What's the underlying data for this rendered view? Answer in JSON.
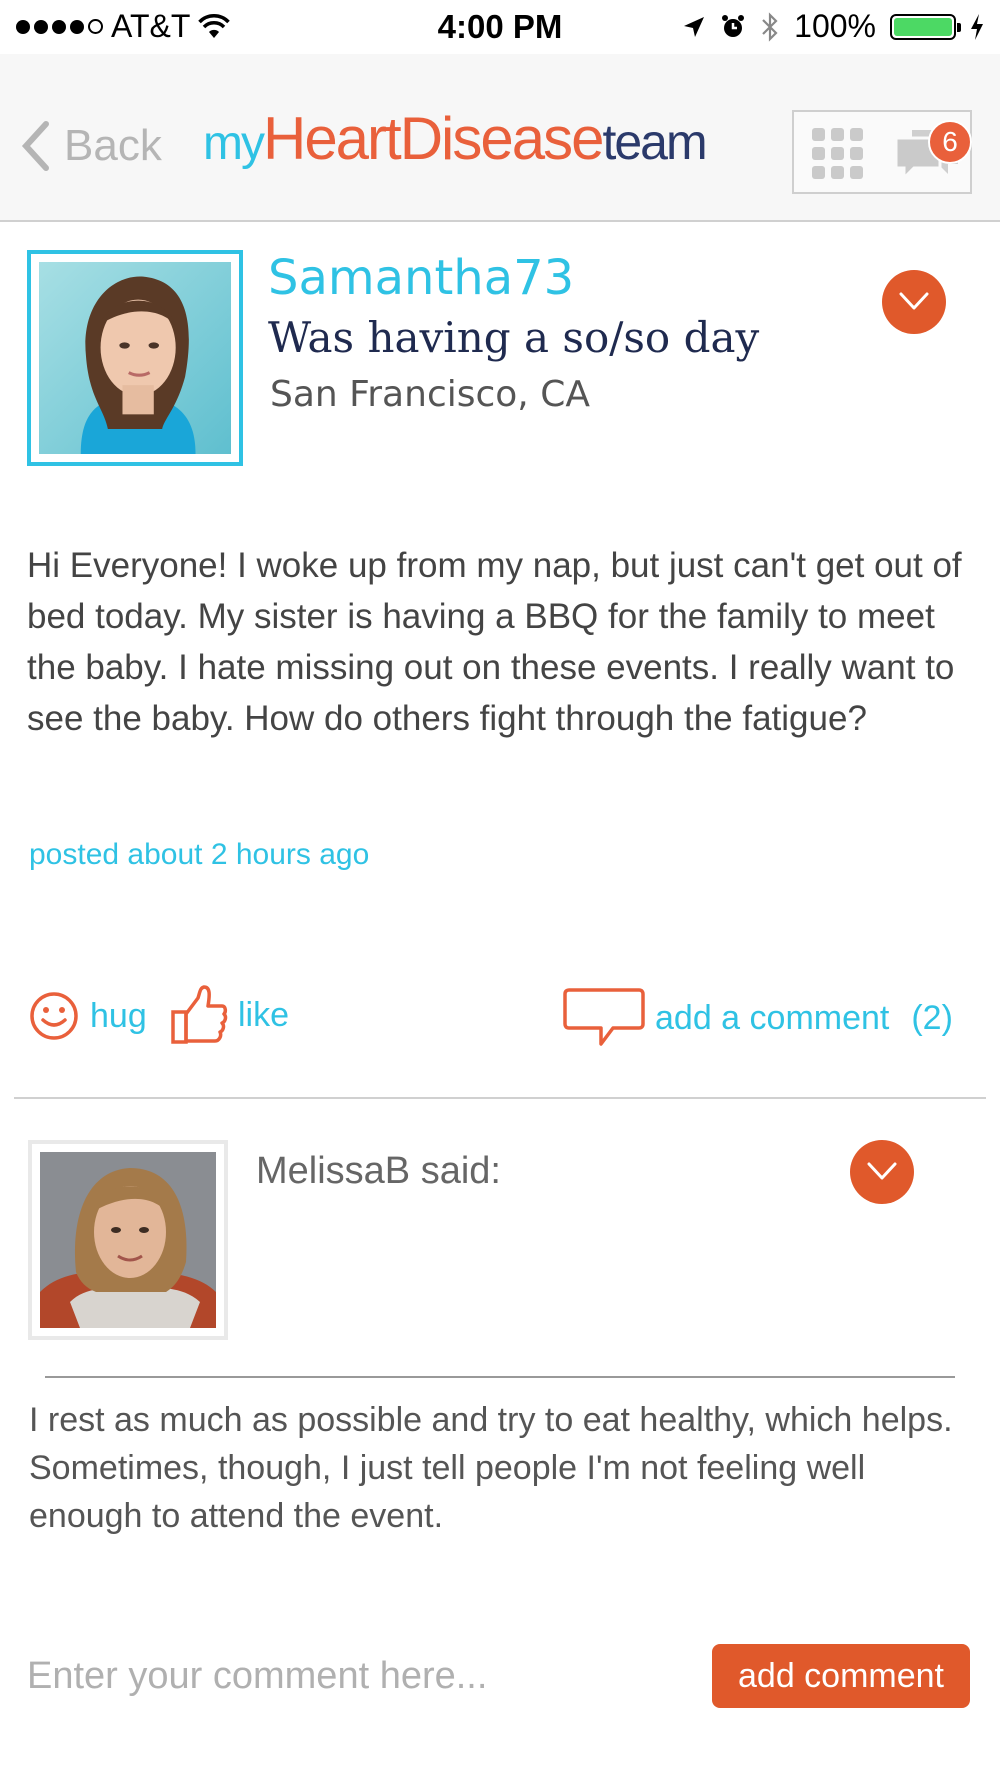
{
  "status_bar": {
    "carrier": "AT&T",
    "time": "4:00 PM",
    "battery": "100%",
    "battery_level": 1.0
  },
  "nav": {
    "back_label": "Back",
    "logo": {
      "my": "my",
      "heart": "Heart",
      "disease": "Disease",
      "team": "team"
    },
    "messages_badge": "6",
    "icons": [
      "back-chevron-icon",
      "grid-menu-icon",
      "messages-icon"
    ]
  },
  "post": {
    "username": "Samantha73",
    "mood_prefix": "Was having a ",
    "mood_value": "so/so",
    "mood_suffix": " day",
    "location": "San Francisco, CA",
    "body": "Hi Everyone! I woke up from my nap, but just can't get out of bed today. My sister is having a BBQ for the family to meet the baby. I hate missing out on these events. I really want to see the baby. How do others fight through the fatigue?",
    "timestamp": "posted about 2 hours ago"
  },
  "actions": {
    "hug": "hug",
    "like": "like",
    "comment": "add a comment",
    "comment_count": "(2)"
  },
  "comment": {
    "author": "MelissaB said:",
    "text": "I rest as much as possible and try to eat healthy, which helps. Sometimes, though, I just tell people I'm not feeling well enough to attend the event."
  },
  "composer": {
    "placeholder": "Enter your comment here...",
    "button_label": "add comment"
  },
  "colors": {
    "accent_cyan": "#2fc2e4",
    "accent_orange": "#e0592b",
    "navy": "#1f2a4f"
  }
}
